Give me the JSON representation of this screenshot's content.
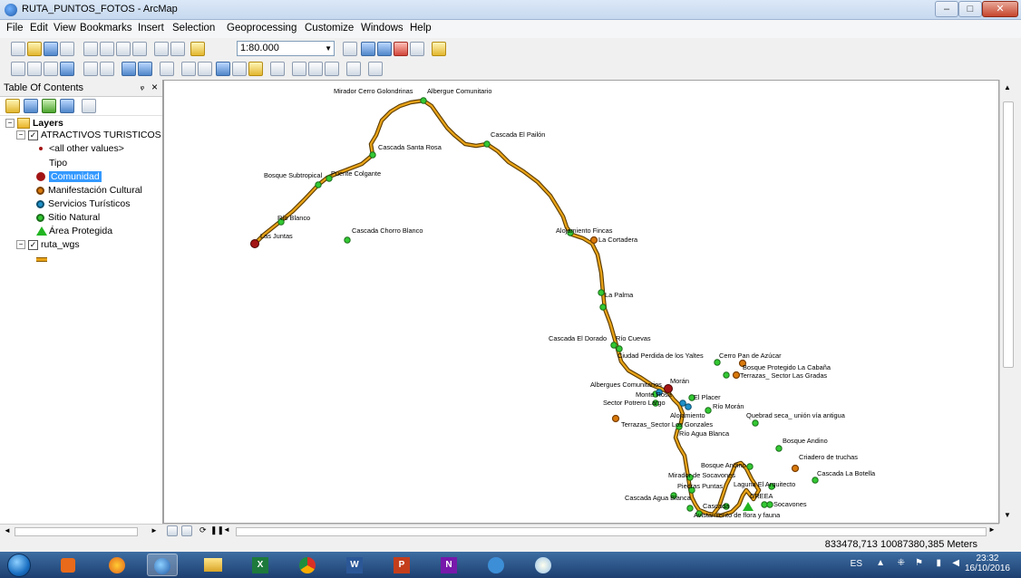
{
  "window": {
    "title": "RUTA_PUNTOS_FOTOS - ArcMap"
  },
  "menu": [
    "File",
    "Edit",
    "View",
    "Bookmarks",
    "Insert",
    "Selection",
    "Geoprocessing",
    "Customize",
    "Windows",
    "Help"
  ],
  "toolbar": {
    "scale": "1:80.000"
  },
  "toc": {
    "title": "Table Of Contents",
    "layers_label": "Layers",
    "layer1": "ATRACTIVOS TURISTICOS",
    "all_other_values": "<all other values>",
    "field": "Tipo",
    "legend": [
      {
        "label": "Comunidad",
        "color": "#a31515",
        "selected": true
      },
      {
        "label": "Manifestación Cultural",
        "color": "#d97a0b"
      },
      {
        "label": "Servicios Turísticos",
        "color": "#1e90c8"
      },
      {
        "label": "Sitio Natural",
        "color": "#33c833"
      },
      {
        "label": "Área Protegida",
        "color": "#22b522"
      }
    ],
    "layer2": "ruta_wgs"
  },
  "map": {
    "route_color": "#e8a317",
    "labels": [
      "Mirador Cerro Golondrinas",
      "Albergue Comunitario",
      "Cascada El Pailón",
      "Cascada Santa Rosa",
      "Bosque Subtropical",
      "Puente Colgante",
      "Río Blanco",
      "Las Juntas",
      "Cascada Chorro Blanco",
      "Alojamiento Fincas",
      "La Cortadera",
      "La Palma",
      "Cascada El Dorado",
      "Río Cuevas",
      "Ciudad Perdida de los Yaltes",
      "Cerro Pan de Azúcar",
      "Bosque Protegido La Cabaña",
      "Terrazas_ Sector Las Gradas",
      "Morán",
      "Albergues Comunitarios",
      "Monte Rosa",
      "El Placer",
      "Sector Potrero Largo",
      "Río Morán",
      "Alojamiento",
      "Quebrad seca_ unión vía antigua",
      "Terrazas_Sector Los Gonzales",
      "Río Agua Blanca",
      "Bosque Andino",
      "Criadero de truchas",
      "Cascada La Botella",
      "Mirador de Socavones",
      "Laguna El Arquitecto",
      "Piedras Puntas",
      "CREEA",
      "Cascada Agua Blanca",
      "Socavones",
      "Cascada",
      "Avistamiento de flora y fauna"
    ]
  },
  "status": {
    "coords": "833478,713 10087380,385 Meters"
  },
  "taskbar": {
    "language": "ES",
    "time": "23:32",
    "date": "16/10/2016"
  }
}
